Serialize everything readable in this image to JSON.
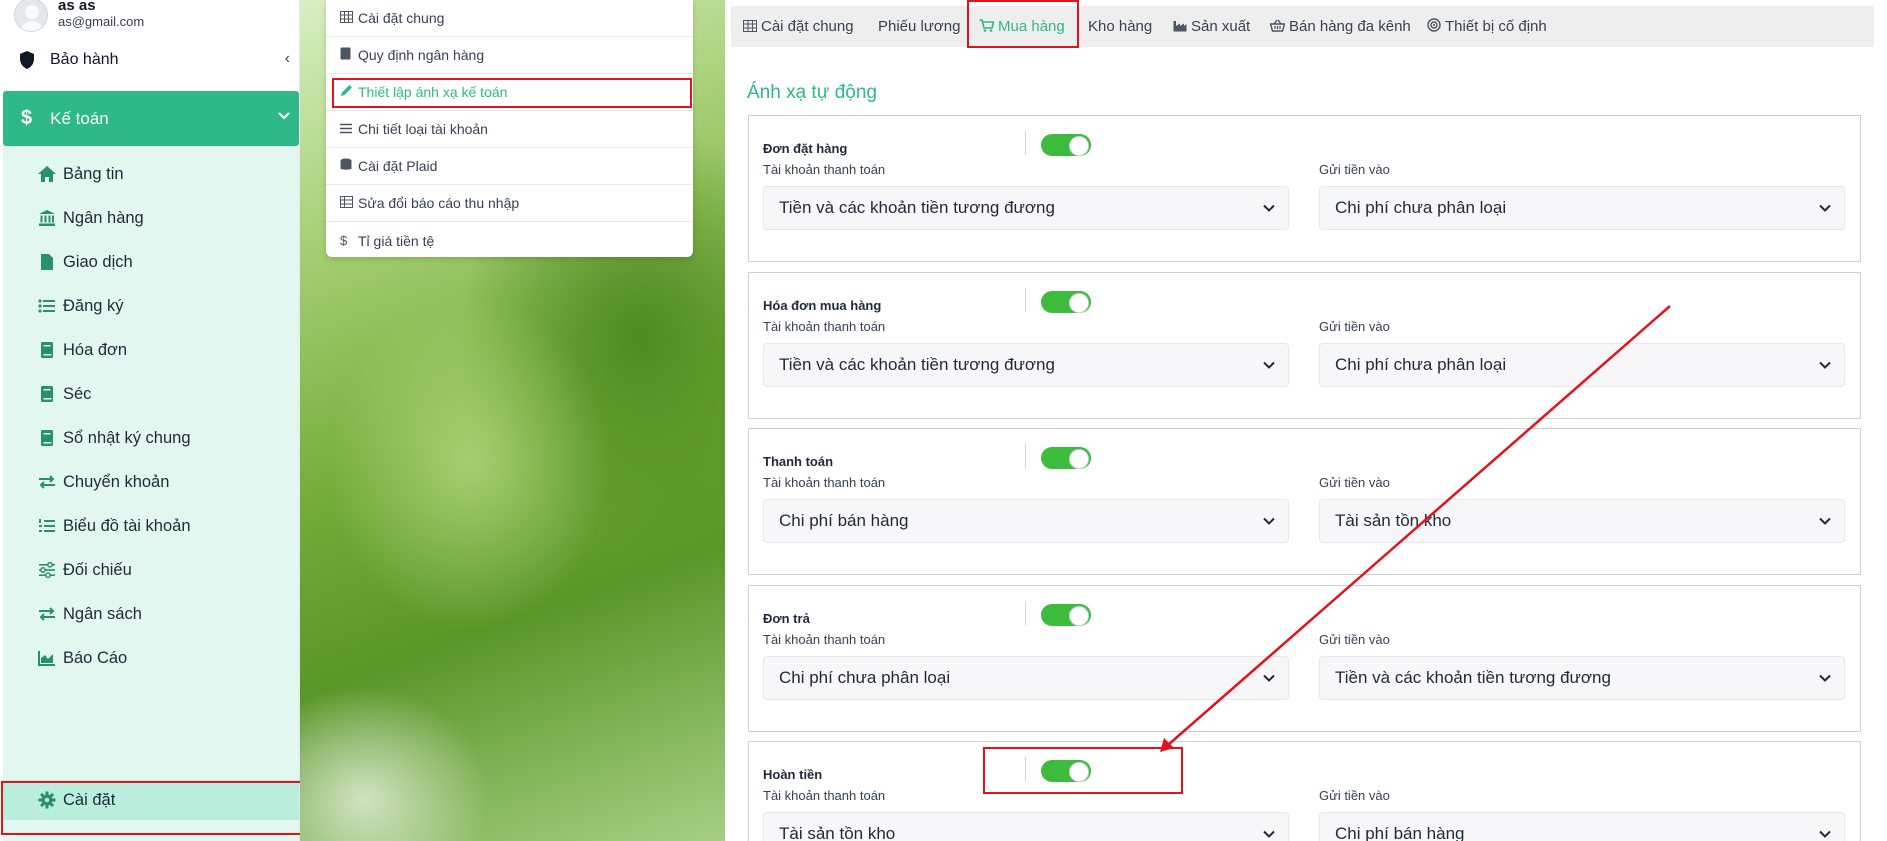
{
  "user": {
    "name": "as as",
    "email": "as@gmail.com"
  },
  "warranty_label": "Bảo hành",
  "group_label": "Kế toán",
  "menu": [
    {
      "label": "Bảng tin",
      "icon": "home-icon"
    },
    {
      "label": "Ngân hàng",
      "icon": "bank-icon"
    },
    {
      "label": "Giao dịch",
      "icon": "file-icon"
    },
    {
      "label": "Đăng ký",
      "icon": "list-icon"
    },
    {
      "label": "Hóa đơn",
      "icon": "book-icon"
    },
    {
      "label": "Séc",
      "icon": "book-icon"
    },
    {
      "label": "Sổ nhật ký chung",
      "icon": "book-icon"
    },
    {
      "label": "Chuyển khoản",
      "icon": "transfer-icon"
    },
    {
      "label": "Biểu đồ tài khoản",
      "icon": "list-ordered-icon"
    },
    {
      "label": "Đối chiếu",
      "icon": "sliders-icon"
    },
    {
      "label": "Ngân sách",
      "icon": "transfer-icon"
    },
    {
      "label": "Báo Cáo",
      "icon": "area-chart-icon"
    },
    {
      "label": "Cài đặt",
      "icon": "gear-icon"
    }
  ],
  "settings_menu": [
    {
      "label": "Cài đặt chung",
      "icon": "table-icon"
    },
    {
      "label": "Quy định ngân hàng",
      "icon": "book-icon"
    },
    {
      "label": "Thiết lập ánh xạ kế toán",
      "icon": "pencil-icon"
    },
    {
      "label": "Chi tiết loại tài khoản",
      "icon": "list-icon"
    },
    {
      "label": "Cài đặt Plaid",
      "icon": "database-icon"
    },
    {
      "label": "Sửa đổi báo cáo thu nhập",
      "icon": "table-icon"
    },
    {
      "label": "Tỉ giá tiền tệ",
      "icon": "dollar-icon"
    }
  ],
  "tabs": [
    {
      "label": "Cài đặt chung",
      "icon": "table-icon"
    },
    {
      "label": "Phiếu lương",
      "icon": ""
    },
    {
      "label": "Mua hàng",
      "icon": "cart-icon"
    },
    {
      "label": "Kho hàng",
      "icon": ""
    },
    {
      "label": "Sản xuất",
      "icon": "industry-icon"
    },
    {
      "label": "Bán hàng đa kênh",
      "icon": "basket-icon"
    },
    {
      "label": "Thiết bị cố định",
      "icon": "target-icon"
    }
  ],
  "section_title": "Ánh xạ tự động",
  "field_labels": {
    "payment_account": "Tài khoản thanh toán",
    "deposit_to": "Gửi tiền vào"
  },
  "mappings": [
    {
      "title": "Đơn đặt hàng",
      "enabled": true,
      "payment_account": "Tiền và các khoản tiền tương đương",
      "deposit_to": "Chi phí chưa phân loại"
    },
    {
      "title": "Hóa đơn mua hàng",
      "enabled": true,
      "payment_account": "Tiền và các khoản tiền tương đương",
      "deposit_to": "Chi phí chưa phân loại"
    },
    {
      "title": "Thanh toán",
      "enabled": true,
      "payment_account": "Chi phí bán hàng",
      "deposit_to": "Tài sản tồn kho"
    },
    {
      "title": "Đơn trả",
      "enabled": true,
      "payment_account": "Chi phí chưa phân loại",
      "deposit_to": "Tiền và các khoản tiền tương đương"
    },
    {
      "title": "Hoàn tiền",
      "enabled": true,
      "payment_account": "Tài sản tồn kho",
      "deposit_to": "Chi phí bán hàng"
    }
  ],
  "colors": {
    "accent": "#2fb888",
    "toggle_on": "#3dbb3d",
    "annotation": "#e3131b",
    "menu_bg": "#e3f7f1"
  }
}
